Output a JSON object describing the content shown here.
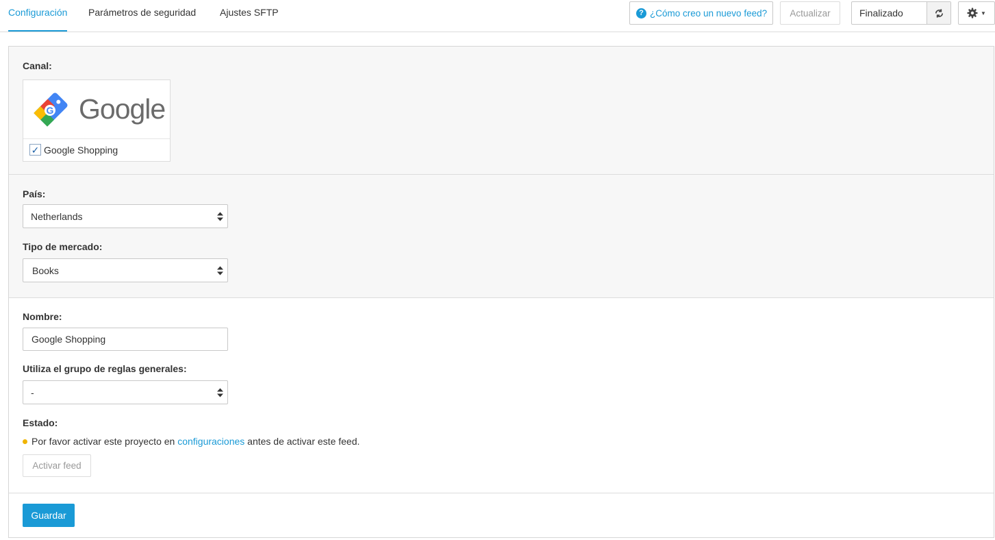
{
  "tabs": [
    {
      "label": "Configuración",
      "active": true
    },
    {
      "label": "Parámetros de seguridad",
      "active": false
    },
    {
      "label": "Ajustes SFTP",
      "active": false
    }
  ],
  "toolbar": {
    "help_label": "¿Cómo creo un nuevo feed?",
    "update_label": "Actualizar",
    "status_value": "Finalizado"
  },
  "channel": {
    "label": "Canal:",
    "logo_text": "Google",
    "option_label": "Google Shopping",
    "checked": true
  },
  "country": {
    "label": "País:",
    "value": "Netherlands"
  },
  "market_type": {
    "label": "Tipo de mercado:",
    "value": "Books"
  },
  "name": {
    "label": "Nombre:",
    "value": "Google Shopping"
  },
  "rule_group": {
    "label": "Utiliza el grupo de reglas generales:",
    "value": "-"
  },
  "state": {
    "label": "Estado:",
    "notice_before": "Por favor activar este proyecto en ",
    "notice_link": "configuraciones",
    "notice_after": " antes de activar este feed.",
    "activate_label": "Activar feed"
  },
  "save_label": "Guardar",
  "colors": {
    "accent": "#1a9ad6",
    "warning_dot": "#f0b400"
  }
}
